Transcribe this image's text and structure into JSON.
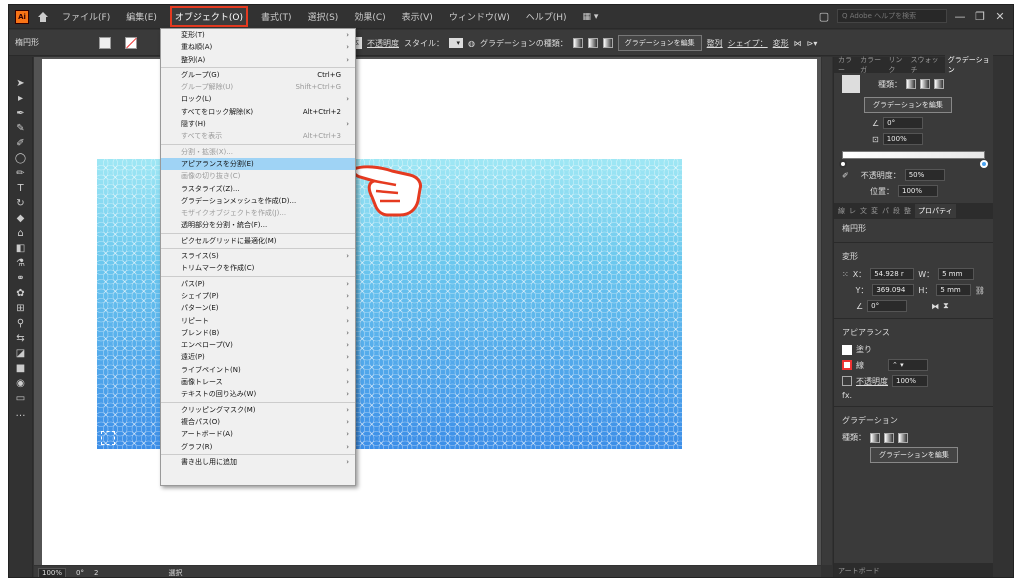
{
  "menubar": {
    "app_icon": "Ai",
    "items": [
      "ファイル(F)",
      "編集(E)",
      "オブジェクト(O)",
      "書式(T)",
      "選択(S)",
      "効果(C)",
      "表示(V)",
      "ウィンドウ(W)",
      "ヘルプ(H)"
    ],
    "search_placeholder": "Q  Adobe ヘルプを検索"
  },
  "controlbar": {
    "selection_label": "楕円形",
    "stroke_style": "基本",
    "opacity_label": "不透明度",
    "style_label": "スタイル：",
    "gradient_type_label": "グラデーションの種類：",
    "edit_gradient_button": "グラデーションを編集",
    "align_label": "整列",
    "shape_label": "シェイプ：",
    "transform_label": "変形"
  },
  "object_menu": {
    "items": [
      {
        "label": "変形(T)",
        "shortcut": "",
        "arrow": true,
        "disabled": false
      },
      {
        "label": "重ね順(A)",
        "shortcut": "",
        "arrow": true,
        "disabled": false
      },
      {
        "label": "整列(A)",
        "shortcut": "",
        "arrow": true,
        "disabled": false
      },
      {
        "sep": true
      },
      {
        "label": "グループ(G)",
        "shortcut": "Ctrl+G",
        "arrow": false,
        "disabled": false
      },
      {
        "label": "グループ解除(U)",
        "shortcut": "Shift+Ctrl+G",
        "arrow": false,
        "disabled": true
      },
      {
        "label": "ロック(L)",
        "shortcut": "",
        "arrow": true,
        "disabled": false
      },
      {
        "label": "すべてをロック解除(K)",
        "shortcut": "Alt+Ctrl+2",
        "arrow": false,
        "disabled": false
      },
      {
        "label": "隠す(H)",
        "shortcut": "",
        "arrow": true,
        "disabled": false
      },
      {
        "label": "すべてを表示",
        "shortcut": "Alt+Ctrl+3",
        "arrow": false,
        "disabled": true
      },
      {
        "sep": true
      },
      {
        "label": "分割・拡張(X)...",
        "shortcut": "",
        "arrow": false,
        "disabled": true
      },
      {
        "label": "アピアランスを分割(E)",
        "shortcut": "",
        "arrow": false,
        "disabled": false,
        "highlight": true
      },
      {
        "label": "画像の切り抜き(C)",
        "shortcut": "",
        "arrow": false,
        "disabled": true
      },
      {
        "label": "ラスタライズ(Z)...",
        "shortcut": "",
        "arrow": false,
        "disabled": false
      },
      {
        "label": "グラデーションメッシュを作成(D)...",
        "shortcut": "",
        "arrow": false,
        "disabled": false
      },
      {
        "label": "モザイクオブジェクトを作成(J)...",
        "shortcut": "",
        "arrow": false,
        "disabled": true
      },
      {
        "label": "透明部分を分割・統合(F)...",
        "shortcut": "",
        "arrow": false,
        "disabled": false
      },
      {
        "sep": true
      },
      {
        "label": "ピクセルグリッドに最適化(M)",
        "shortcut": "",
        "arrow": false,
        "disabled": false
      },
      {
        "sep": true
      },
      {
        "label": "スライス(S)",
        "shortcut": "",
        "arrow": true,
        "disabled": false
      },
      {
        "label": "トリムマークを作成(C)",
        "shortcut": "",
        "arrow": false,
        "disabled": false
      },
      {
        "sep": true
      },
      {
        "label": "パス(P)",
        "shortcut": "",
        "arrow": true,
        "disabled": false
      },
      {
        "label": "シェイプ(P)",
        "shortcut": "",
        "arrow": true,
        "disabled": false
      },
      {
        "label": "パターン(E)",
        "shortcut": "",
        "arrow": true,
        "disabled": false
      },
      {
        "label": "リピート",
        "shortcut": "",
        "arrow": true,
        "disabled": false
      },
      {
        "label": "ブレンド(B)",
        "shortcut": "",
        "arrow": true,
        "disabled": false
      },
      {
        "label": "エンベロープ(V)",
        "shortcut": "",
        "arrow": true,
        "disabled": false
      },
      {
        "label": "遠近(P)",
        "shortcut": "",
        "arrow": true,
        "disabled": false
      },
      {
        "label": "ライブペイント(N)",
        "shortcut": "",
        "arrow": true,
        "disabled": false
      },
      {
        "label": "画像トレース",
        "shortcut": "",
        "arrow": true,
        "disabled": false
      },
      {
        "label": "テキストの回り込み(W)",
        "shortcut": "",
        "arrow": true,
        "disabled": false
      },
      {
        "sep": true
      },
      {
        "label": "クリッピングマスク(M)",
        "shortcut": "",
        "arrow": true,
        "disabled": false
      },
      {
        "label": "複合パス(O)",
        "shortcut": "",
        "arrow": true,
        "disabled": false
      },
      {
        "label": "アートボード(A)",
        "shortcut": "",
        "arrow": true,
        "disabled": false
      },
      {
        "label": "グラフ(R)",
        "shortcut": "",
        "arrow": true,
        "disabled": false
      },
      {
        "sep": true
      },
      {
        "label": "書き出し用に追加",
        "shortcut": "",
        "arrow": true,
        "disabled": false
      }
    ]
  },
  "gradient_panel": {
    "tabs": [
      "カラー",
      "カラーガ",
      "リンク",
      "スウォッチ",
      "グラデーション"
    ],
    "type_label": "種類：",
    "edit_button": "グラデーションを編集",
    "angle": "0°",
    "aspect": "100%",
    "opacity_label": "不透明度：",
    "opacity": "50%",
    "location_label": "位置：",
    "location": "100%"
  },
  "properties_panel": {
    "tabs": [
      "線",
      "レ",
      "文",
      "変",
      "パ",
      "段",
      "整",
      "プロパティ"
    ],
    "selection": "楕円形",
    "transform_title": "変形",
    "x_label": "X：",
    "x": "54.928 r",
    "y_label": "Y：",
    "y": "369.094",
    "w_label": "W：",
    "w": "5 mm",
    "h_label": "H：",
    "h": "5 mm",
    "rotate": "0°",
    "appearance_title": "アピアランス",
    "fill_label": "塗り",
    "stroke_label": "線",
    "opacity_label": "不透明度",
    "opacity": "100%",
    "fx_label": "fx.",
    "gradient_title": "グラデーション",
    "gradient_type_label": "種類：",
    "gradient_edit_button": "グラデーションを編集",
    "artboard_label": "アートボード"
  },
  "statusbar": {
    "zoom": "100%",
    "rotate": "0°",
    "artboard": "2",
    "tool": "選択"
  }
}
